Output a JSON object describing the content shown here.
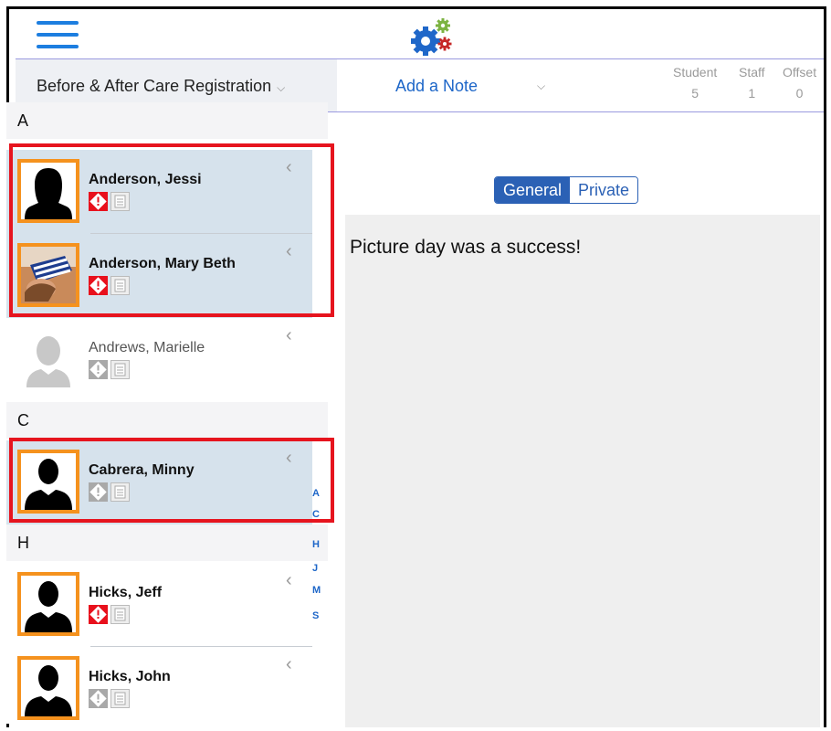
{
  "header": {
    "menu_icon": "hamburger-icon",
    "logo_icon": "gears-icon",
    "program": "Before & After Care Registration",
    "add_note": "Add a Note",
    "stats": [
      {
        "label": "Student",
        "value": "5"
      },
      {
        "label": "Staff",
        "value": "1"
      },
      {
        "label": "Offset",
        "value": "0"
      }
    ]
  },
  "sections": {
    "a": "A",
    "c": "C",
    "h": "H"
  },
  "students": [
    {
      "name": "Anderson, Jessi",
      "alert": "red"
    },
    {
      "name": "Anderson, Mary Beth",
      "alert": "red"
    },
    {
      "name": "Andrews, Marielle",
      "alert": "gray"
    },
    {
      "name": "Cabrera, Minny",
      "alert": "gray"
    },
    {
      "name": "Hicks, Jeff",
      "alert": "red"
    },
    {
      "name": "Hicks, John",
      "alert": "gray"
    }
  ],
  "index": [
    "A",
    "C",
    "H",
    "J",
    "M",
    "S"
  ],
  "notes": {
    "tabs": {
      "general": "General",
      "private": "Private"
    },
    "active_tab": "General",
    "text": "Picture day was a success!"
  },
  "colors": {
    "accent": "#1d66c8",
    "selected_row": "#d6e2ec",
    "avatar_border": "#f5921e",
    "alert_red": "#e8101c",
    "highlight_box": "#e6141e"
  }
}
